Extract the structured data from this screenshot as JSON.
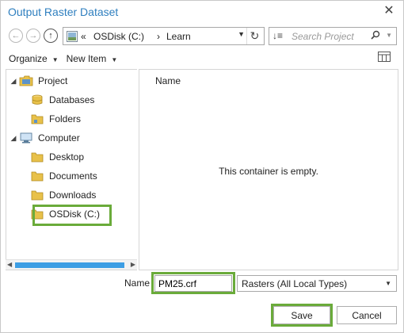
{
  "window": {
    "title": "Output Raster Dataset",
    "close_glyph": "✕"
  },
  "nav": {
    "back_glyph": "←",
    "forward_glyph": "→",
    "up_glyph": "↑",
    "breadcrumb_sep": "«",
    "path": [
      "OSDisk (C:)",
      "Learn"
    ],
    "path_arrow": "›",
    "refresh_glyph": "↻"
  },
  "search": {
    "placeholder": "Search Project"
  },
  "toolbar": {
    "organize": "Organize",
    "new_item": "New Item"
  },
  "tree": [
    {
      "label": "Project",
      "icon": "project-icon",
      "expander": "◢",
      "level": 0
    },
    {
      "label": "Databases",
      "icon": "database-icon",
      "expander": "",
      "level": 1
    },
    {
      "label": "Folders",
      "icon": "folders-icon",
      "expander": "",
      "level": 1
    },
    {
      "label": "Computer",
      "icon": "computer-icon",
      "expander": "◢",
      "level": 0
    },
    {
      "label": "Desktop",
      "icon": "folder-icon",
      "expander": "",
      "level": 1
    },
    {
      "label": "Documents",
      "icon": "folder-icon",
      "expander": "",
      "level": 1
    },
    {
      "label": "Downloads",
      "icon": "folder-icon",
      "expander": "",
      "level": 1
    },
    {
      "label": "OSDisk (C:)",
      "icon": "folder-icon",
      "expander": "",
      "level": 1,
      "highlighted": true
    }
  ],
  "content": {
    "column_header": "Name",
    "empty_message": "This container is empty."
  },
  "footer": {
    "name_label": "Name",
    "name_value": "PM25.crf",
    "type_value": "Rasters (All Local Types)",
    "save": "Save",
    "cancel": "Cancel"
  },
  "colors": {
    "title": "#2f7fbf",
    "highlight": "#6aab3a",
    "folder": "#e8c14a",
    "scroll_thumb": "#3d9ee4"
  }
}
